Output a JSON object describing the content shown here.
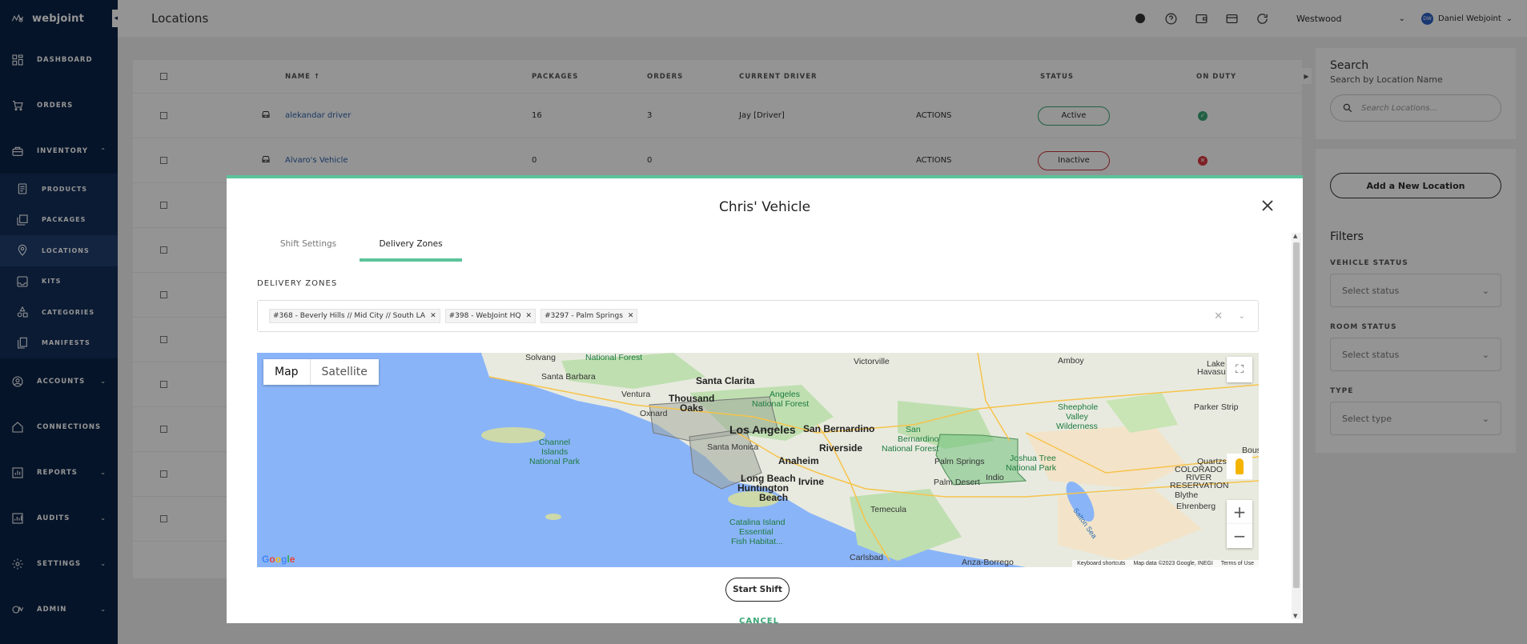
{
  "brand": {
    "name": "webjoint"
  },
  "sidebar": {
    "items": [
      {
        "label": "DASHBOARD",
        "icon": "dashboard-icon"
      },
      {
        "label": "ORDERS",
        "icon": "cart-icon"
      },
      {
        "label": "INVENTORY",
        "icon": "inventory-icon",
        "expanded": true
      }
    ],
    "inventory_sub": [
      {
        "label": "PRODUCTS",
        "icon": "products-icon"
      },
      {
        "label": "PACKAGES",
        "icon": "packages-icon"
      },
      {
        "label": "LOCATIONS",
        "icon": "location-pin-icon",
        "active": true
      },
      {
        "label": "KITS",
        "icon": "kits-icon"
      },
      {
        "label": "CATEGORIES",
        "icon": "categories-icon"
      },
      {
        "label": "MANIFESTS",
        "icon": "manifests-icon"
      }
    ],
    "bottom_items": [
      {
        "label": "ACCOUNTS",
        "icon": "accounts-icon"
      },
      {
        "label": "CONNECTIONS",
        "icon": "home-icon"
      },
      {
        "label": "REPORTS",
        "icon": "reports-icon"
      },
      {
        "label": "AUDITS",
        "icon": "audits-icon"
      },
      {
        "label": "SETTINGS",
        "icon": "gear-icon"
      },
      {
        "label": "ADMIN",
        "icon": "admin-icon"
      }
    ]
  },
  "header": {
    "title": "Locations",
    "location": "Westwood",
    "user_name": "Daniel Webjoint",
    "user_initials": "DW"
  },
  "table": {
    "columns": [
      "NAME",
      "PACKAGES",
      "ORDERS",
      "CURRENT DRIVER",
      "STATUS",
      "ON DUTY"
    ],
    "rows": [
      {
        "name": "alekandar driver",
        "packages": "16",
        "orders": "3",
        "driver": "Jay [Driver]",
        "actions": "ACTIONS",
        "status": "Active",
        "on_duty": true
      },
      {
        "name": "Alvaro's Vehicle",
        "packages": "0",
        "orders": "0",
        "driver": "",
        "actions": "ACTIONS",
        "status": "Inactive",
        "on_duty": false
      }
    ]
  },
  "right_panel": {
    "search_title": "Search",
    "search_subtitle": "Search by Location Name",
    "search_placeholder": "Search Locations...",
    "add_button": "Add a New Location",
    "filters_title": "Filters",
    "filters": [
      {
        "label": "VEHICLE STATUS",
        "placeholder": "Select status"
      },
      {
        "label": "ROOM STATUS",
        "placeholder": "Select status"
      },
      {
        "label": "TYPE",
        "placeholder": "Select type"
      }
    ]
  },
  "modal": {
    "title": "Chris' Vehicle",
    "tabs": [
      "Shift Settings",
      "Delivery Zones"
    ],
    "active_tab": "Delivery Zones",
    "zones_label": "DELIVERY ZONES",
    "zones": [
      "#368 - Beverly Hills // Mid City // South LA",
      "#398 - WebJoint HQ",
      "#3297 - Palm Springs"
    ],
    "map": {
      "toggle_map": "Map",
      "toggle_satellite": "Satellite",
      "labels": {
        "solvang": "Solvang",
        "los_padres": "National Forest",
        "santa_barbara": "Santa Barbara",
        "ventura": "Ventura",
        "oxnard": "Oxnard",
        "santa_clarita": "Santa Clarita",
        "thousand_oaks": "Thousand",
        "thousand_oaks2": "Oaks",
        "angeles": "Angeles",
        "angeles2": "National Forest",
        "los_angeles": "Los Angeles",
        "san_bernardino": "San Bernardino",
        "santa_monica": "Santa Monica",
        "riverside": "Riverside",
        "anaheim": "Anaheim",
        "long_beach": "Long Beach",
        "huntington": "Huntington",
        "beach": "Beach",
        "irvine": "Irvine",
        "channel_islands": "Channel",
        "channel_islands2": "Islands",
        "channel_islands3": "National Park",
        "catalina": "Catalina Island",
        "catalina2": "Essential",
        "catalina3": "Fish Habitat...",
        "temecula": "Temecula",
        "carlsbad": "Carlsbad",
        "victorville": "Victorville",
        "amboy": "Amboy",
        "sb_forest": "San",
        "sb_forest2": "Bernardino",
        "sb_forest3": "National Forest",
        "palm_springs": "Palm Springs",
        "palm_desert": "Palm Desert",
        "indio": "Indio",
        "joshua_tree": "Joshua Tree",
        "joshua_tree2": "National Park",
        "sheephole": "Sheephole",
        "sheephole2": "Valley",
        "sheephole3": "Wilderness",
        "lake_havasu": "Lake",
        "lake_havasu2": "Havasu C",
        "quartzsite": "Quartzsite",
        "parker_strip": "Parker Strip",
        "colorado_river": "COLORADO",
        "colorado_river2": "RIVER",
        "colorado_river3": "RESERVATION",
        "blythe": "Blythe",
        "ehrenberg": "Ehrenberg",
        "salton_sea": "Salton Sea",
        "anza_borrego": "Anza-Borrego",
        "bous": "Bous"
      },
      "google": "Google",
      "footer_shortcuts": "Keyboard shortcuts",
      "footer_data": "Map data ©2023 Google, INEGI",
      "footer_terms": "Terms of Use"
    },
    "start_button": "Start Shift",
    "cancel": "CANCEL"
  },
  "colors": {
    "sidebar_bg": "#0b2447",
    "accent": "#5bc49a",
    "active_status": "#3aa574",
    "inactive_status": "#c9353a",
    "link": "#2b5fa8"
  }
}
